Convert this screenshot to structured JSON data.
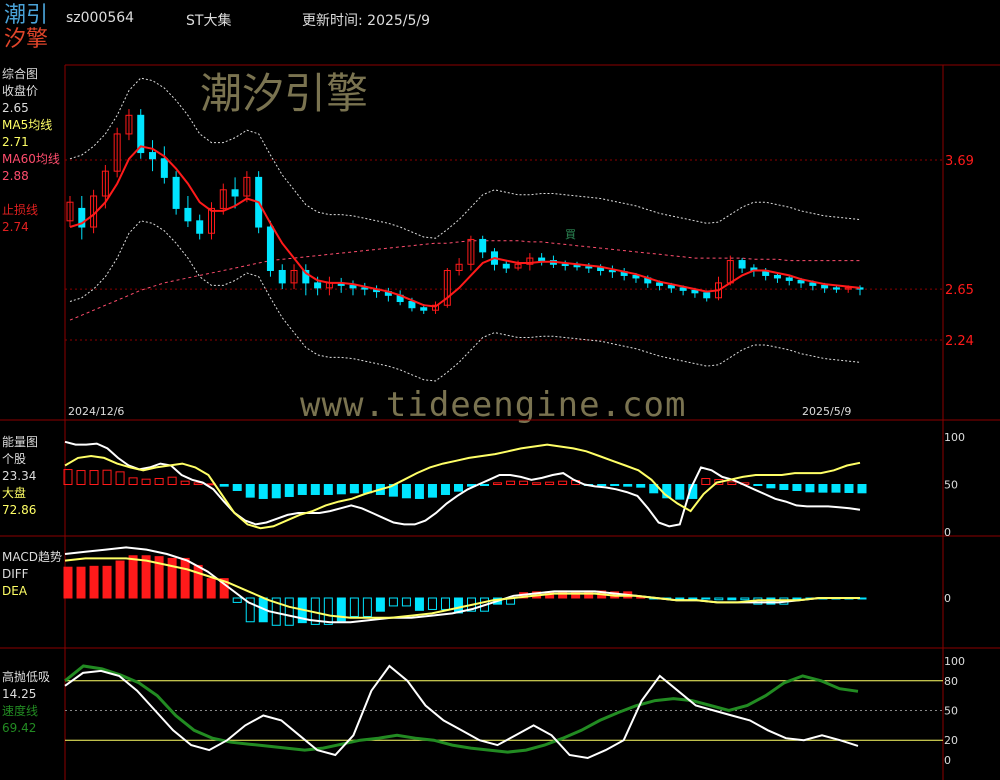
{
  "header": {
    "logo_top": "潮引",
    "logo_bottom": "汐擎",
    "code": "sz000564",
    "name": "ST大集",
    "update_label": "更新时间:",
    "update_date": "2025/5/9"
  },
  "watermarks": {
    "cn": "潮汐引擎",
    "url": "www.tideengine.com"
  },
  "colors": {
    "up": "#ff1a1a",
    "down": "#00e5ff",
    "ma5": "#ffff66",
    "ma60": "#ff4d6d",
    "stop": "#e02020",
    "grid": "#8b0000",
    "white": "#ffffff",
    "green": "#228b22"
  },
  "panels": {
    "main": {
      "title": "综合图",
      "close_label": "收盘价",
      "close_value": "2.65",
      "ma5_label": "MA5均线",
      "ma5_value": "2.71",
      "ma60_label": "MA60均线",
      "ma60_value": "2.88",
      "stop_label": "止损线",
      "stop_value": "2.74",
      "start_date": "2024/12/6",
      "end_date": "2025/5/9",
      "price_ticks": [
        "3.69",
        "2.65",
        "2.24"
      ],
      "marker_small": "買"
    },
    "energy": {
      "title": "能量图",
      "stock_label": "个股",
      "stock_value": "23.34",
      "market_label": "大盘",
      "market_value": "72.86",
      "ticks": [
        "100",
        "50",
        "0"
      ]
    },
    "macd": {
      "title": "MACD趋势",
      "diff_label": "DIFF",
      "dea_label": "DEA",
      "ticks": [
        "0"
      ]
    },
    "hl": {
      "title": "高抛低吸",
      "value": "14.25",
      "speed_label": "速度线",
      "speed_value": "69.42",
      "ticks": [
        "100",
        "80",
        "50",
        "20",
        "0"
      ]
    }
  },
  "chart_data": {
    "type": "candlestick",
    "x_range": [
      "2024/12/6",
      "2025/5/9"
    ],
    "price_ticks": [
      3.69,
      2.65,
      2.24
    ],
    "candles": [
      [
        3.2,
        3.35,
        3.15,
        3.4
      ],
      [
        3.3,
        3.15,
        3.05,
        3.4
      ],
      [
        3.15,
        3.4,
        3.1,
        3.45
      ],
      [
        3.4,
        3.6,
        3.3,
        3.65
      ],
      [
        3.6,
        3.9,
        3.55,
        3.95
      ],
      [
        3.9,
        4.05,
        3.85,
        4.1
      ],
      [
        4.05,
        3.75,
        3.7,
        4.1
      ],
      [
        3.75,
        3.7,
        3.6,
        3.85
      ],
      [
        3.7,
        3.55,
        3.5,
        3.8
      ],
      [
        3.55,
        3.3,
        3.25,
        3.6
      ],
      [
        3.3,
        3.2,
        3.15,
        3.4
      ],
      [
        3.2,
        3.1,
        3.05,
        3.25
      ],
      [
        3.1,
        3.3,
        3.05,
        3.35
      ],
      [
        3.3,
        3.45,
        3.25,
        3.5
      ],
      [
        3.45,
        3.4,
        3.3,
        3.55
      ],
      [
        3.4,
        3.55,
        3.35,
        3.6
      ],
      [
        3.55,
        3.15,
        3.1,
        3.6
      ],
      [
        3.15,
        2.8,
        2.75,
        3.2
      ],
      [
        2.8,
        2.7,
        2.65,
        2.85
      ],
      [
        2.7,
        2.8,
        2.65,
        2.85
      ],
      [
        2.8,
        2.7,
        2.6,
        2.85
      ],
      [
        2.7,
        2.66,
        2.6,
        2.75
      ],
      [
        2.66,
        2.7,
        2.6,
        2.75
      ],
      [
        2.7,
        2.68,
        2.62,
        2.74
      ],
      [
        2.68,
        2.66,
        2.6,
        2.72
      ],
      [
        2.66,
        2.65,
        2.6,
        2.7
      ],
      [
        2.65,
        2.63,
        2.58,
        2.68
      ],
      [
        2.63,
        2.6,
        2.55,
        2.66
      ],
      [
        2.6,
        2.55,
        2.52,
        2.64
      ],
      [
        2.55,
        2.5,
        2.47,
        2.58
      ],
      [
        2.5,
        2.48,
        2.45,
        2.53
      ],
      [
        2.48,
        2.52,
        2.45,
        2.55
      ],
      [
        2.52,
        2.8,
        2.5,
        2.82
      ],
      [
        2.8,
        2.85,
        2.76,
        2.9
      ],
      [
        2.85,
        3.05,
        2.8,
        3.08
      ],
      [
        3.05,
        2.95,
        2.9,
        3.08
      ],
      [
        2.95,
        2.85,
        2.8,
        2.98
      ],
      [
        2.85,
        2.82,
        2.78,
        2.88
      ],
      [
        2.82,
        2.85,
        2.8,
        2.88
      ],
      [
        2.85,
        2.9,
        2.8,
        2.94
      ],
      [
        2.9,
        2.88,
        2.84,
        2.94
      ],
      [
        2.88,
        2.85,
        2.82,
        2.92
      ],
      [
        2.85,
        2.84,
        2.8,
        2.88
      ],
      [
        2.84,
        2.83,
        2.8,
        2.87
      ],
      [
        2.83,
        2.82,
        2.78,
        2.86
      ],
      [
        2.82,
        2.8,
        2.76,
        2.85
      ],
      [
        2.8,
        2.79,
        2.74,
        2.84
      ],
      [
        2.79,
        2.76,
        2.72,
        2.82
      ],
      [
        2.76,
        2.74,
        2.7,
        2.78
      ],
      [
        2.74,
        2.7,
        2.66,
        2.76
      ],
      [
        2.7,
        2.68,
        2.64,
        2.72
      ],
      [
        2.68,
        2.66,
        2.62,
        2.7
      ],
      [
        2.66,
        2.64,
        2.6,
        2.68
      ],
      [
        2.64,
        2.62,
        2.58,
        2.66
      ],
      [
        2.62,
        2.58,
        2.55,
        2.64
      ],
      [
        2.58,
        2.7,
        2.56,
        2.75
      ],
      [
        2.7,
        2.88,
        2.68,
        2.92
      ],
      [
        2.88,
        2.82,
        2.78,
        2.9
      ],
      [
        2.82,
        2.8,
        2.75,
        2.85
      ],
      [
        2.8,
        2.76,
        2.72,
        2.82
      ],
      [
        2.76,
        2.74,
        2.7,
        2.78
      ],
      [
        2.74,
        2.72,
        2.68,
        2.76
      ],
      [
        2.72,
        2.7,
        2.66,
        2.74
      ],
      [
        2.7,
        2.68,
        2.64,
        2.72
      ],
      [
        2.68,
        2.66,
        2.62,
        2.7
      ],
      [
        2.66,
        2.65,
        2.62,
        2.68
      ],
      [
        2.65,
        2.66,
        2.62,
        2.68
      ],
      [
        2.66,
        2.65,
        2.6,
        2.68
      ]
    ],
    "ma5": [
      3.15,
      3.18,
      3.25,
      3.35,
      3.5,
      3.7,
      3.8,
      3.78,
      3.72,
      3.62,
      3.5,
      3.35,
      3.28,
      3.28,
      3.32,
      3.38,
      3.35,
      3.18,
      3.02,
      2.9,
      2.78,
      2.72,
      2.7,
      2.7,
      2.69,
      2.67,
      2.65,
      2.63,
      2.6,
      2.56,
      2.52,
      2.51,
      2.58,
      2.66,
      2.76,
      2.86,
      2.9,
      2.88,
      2.86,
      2.86,
      2.87,
      2.87,
      2.86,
      2.85,
      2.84,
      2.83,
      2.81,
      2.79,
      2.77,
      2.74,
      2.71,
      2.69,
      2.67,
      2.65,
      2.63,
      2.64,
      2.7,
      2.76,
      2.8,
      2.8,
      2.78,
      2.76,
      2.73,
      2.71,
      2.69,
      2.68,
      2.67,
      2.66
    ],
    "ma60": [
      2.4,
      2.44,
      2.48,
      2.52,
      2.56,
      2.6,
      2.64,
      2.67,
      2.7,
      2.72,
      2.74,
      2.76,
      2.78,
      2.8,
      2.82,
      2.84,
      2.86,
      2.88,
      2.89,
      2.9,
      2.91,
      2.92,
      2.93,
      2.94,
      2.95,
      2.96,
      2.97,
      2.98,
      2.99,
      3.0,
      3.01,
      3.02,
      3.02,
      3.03,
      3.04,
      3.04,
      3.04,
      3.04,
      3.04,
      3.03,
      3.03,
      3.02,
      3.01,
      3.0,
      2.99,
      2.98,
      2.97,
      2.96,
      2.95,
      2.94,
      2.93,
      2.92,
      2.91,
      2.9,
      2.9,
      2.9,
      2.9,
      2.9,
      2.89,
      2.89,
      2.89,
      2.88,
      2.88,
      2.88,
      2.88,
      2.88,
      2.88,
      2.88
    ],
    "energy": {
      "ticks": [
        100,
        50,
        0
      ],
      "stock": [
        95,
        92,
        92,
        93,
        88,
        78,
        70,
        66,
        68,
        72,
        70,
        60,
        55,
        52,
        45,
        32,
        20,
        12,
        8,
        10,
        14,
        18,
        20,
        20,
        20,
        22,
        25,
        28,
        25,
        20,
        15,
        10,
        8,
        8,
        12,
        20,
        30,
        38,
        45,
        50,
        55,
        60,
        60,
        58,
        55,
        57,
        60,
        62,
        55,
        50,
        48,
        47,
        45,
        42,
        38,
        25,
        10,
        6,
        8,
        45,
        68,
        65,
        58,
        55,
        50,
        45,
        40,
        35,
        32,
        28,
        27,
        27,
        27,
        26,
        25,
        23.34
      ],
      "market": [
        70,
        78,
        80,
        78,
        72,
        68,
        65,
        68,
        70,
        72,
        68,
        60,
        40,
        20,
        8,
        4,
        6,
        12,
        18,
        22,
        28,
        32,
        35,
        40,
        44,
        48,
        55,
        62,
        68,
        72,
        75,
        78,
        80,
        82,
        85,
        88,
        90,
        92,
        90,
        88,
        85,
        80,
        75,
        70,
        65,
        55,
        40,
        30,
        22,
        40,
        52,
        55,
        58,
        60,
        60,
        60,
        62,
        62,
        62,
        65,
        70,
        72.86
      ]
    },
    "macd": {
      "diff": [
        0.2,
        0.21,
        0.22,
        0.23,
        0.22,
        0.2,
        0.17,
        0.12,
        0.05,
        -0.02,
        -0.06,
        -0.08,
        -0.1,
        -0.11,
        -0.11,
        -0.1,
        -0.09,
        -0.09,
        -0.08,
        -0.07,
        -0.05,
        -0.02,
        0.01,
        0.02,
        0.03,
        0.03,
        0.03,
        0.02,
        0.01,
        0.0,
        -0.01,
        -0.01,
        -0.02,
        -0.02,
        -0.02,
        -0.02,
        -0.01,
        0.0,
        0.0,
        0.0
      ],
      "dea": [
        0.17,
        0.18,
        0.18,
        0.18,
        0.17,
        0.15,
        0.13,
        0.1,
        0.07,
        0.03,
        -0.01,
        -0.04,
        -0.06,
        -0.08,
        -0.09,
        -0.09,
        -0.09,
        -0.08,
        -0.07,
        -0.05,
        -0.03,
        -0.01,
        0.0,
        0.01,
        0.02,
        0.02,
        0.02,
        0.01,
        0.01,
        0.0,
        -0.01,
        -0.01,
        -0.02,
        -0.02,
        -0.01,
        -0.01,
        -0.01,
        0.0,
        0.0,
        0.0
      ]
    },
    "hl": {
      "ticks": [
        100,
        80,
        50,
        20,
        0
      ],
      "value": [
        75,
        88,
        90,
        85,
        70,
        50,
        30,
        15,
        10,
        20,
        35,
        45,
        40,
        25,
        10,
        5,
        25,
        70,
        95,
        80,
        55,
        40,
        30,
        20,
        15,
        25,
        35,
        25,
        5,
        2,
        10,
        20,
        60,
        85,
        70,
        55,
        50,
        45,
        40,
        30,
        22,
        20,
        25,
        20,
        14.25
      ],
      "speed": [
        80,
        95,
        92,
        86,
        78,
        65,
        45,
        30,
        22,
        18,
        16,
        14,
        12,
        10,
        12,
        16,
        20,
        22,
        25,
        22,
        20,
        15,
        12,
        10,
        8,
        10,
        15,
        22,
        30,
        40,
        48,
        55,
        60,
        62,
        60,
        55,
        50,
        55,
        65,
        78,
        85,
        80,
        72,
        69.42
      ]
    }
  }
}
